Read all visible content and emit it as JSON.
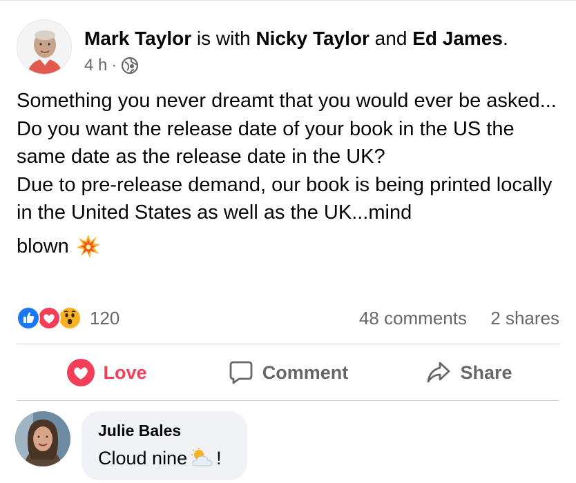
{
  "post": {
    "author": "Mark Taylor",
    "with_text": " is with ",
    "tagged_1": "Nicky Taylor",
    "and_text": " and ",
    "tagged_2": "Ed James",
    "period": ".",
    "time": "4 h",
    "separator": "·",
    "privacy_icon": "globe-icon",
    "text_lines": [
      "Something you never dreamt that you would ever be asked...",
      "Do you want the release date of your book in the US the same date as the release date in the UK?",
      "Due to pre-release demand, our book is being printed locally in the United States as well as the UK...mind"
    ],
    "last_line": "blown",
    "last_emoji": "collision-emoji"
  },
  "stats": {
    "reaction_icons": [
      "like-icon",
      "love-icon",
      "wow-icon"
    ],
    "reaction_count": "120",
    "comments": "48 comments",
    "shares": "2 shares"
  },
  "actions": {
    "love_label": "Love",
    "comment_label": "Comment",
    "share_label": "Share"
  },
  "comment": {
    "author": "Julie Bales",
    "text": "Cloud nine",
    "emoji": "sun-behind-cloud-emoji",
    "suffix": "!"
  },
  "colors": {
    "love": "#f33e58",
    "like": "#1877f2",
    "wow": "#f7b125",
    "secondary_text": "#65676b",
    "bubble": "#f0f2f5"
  }
}
